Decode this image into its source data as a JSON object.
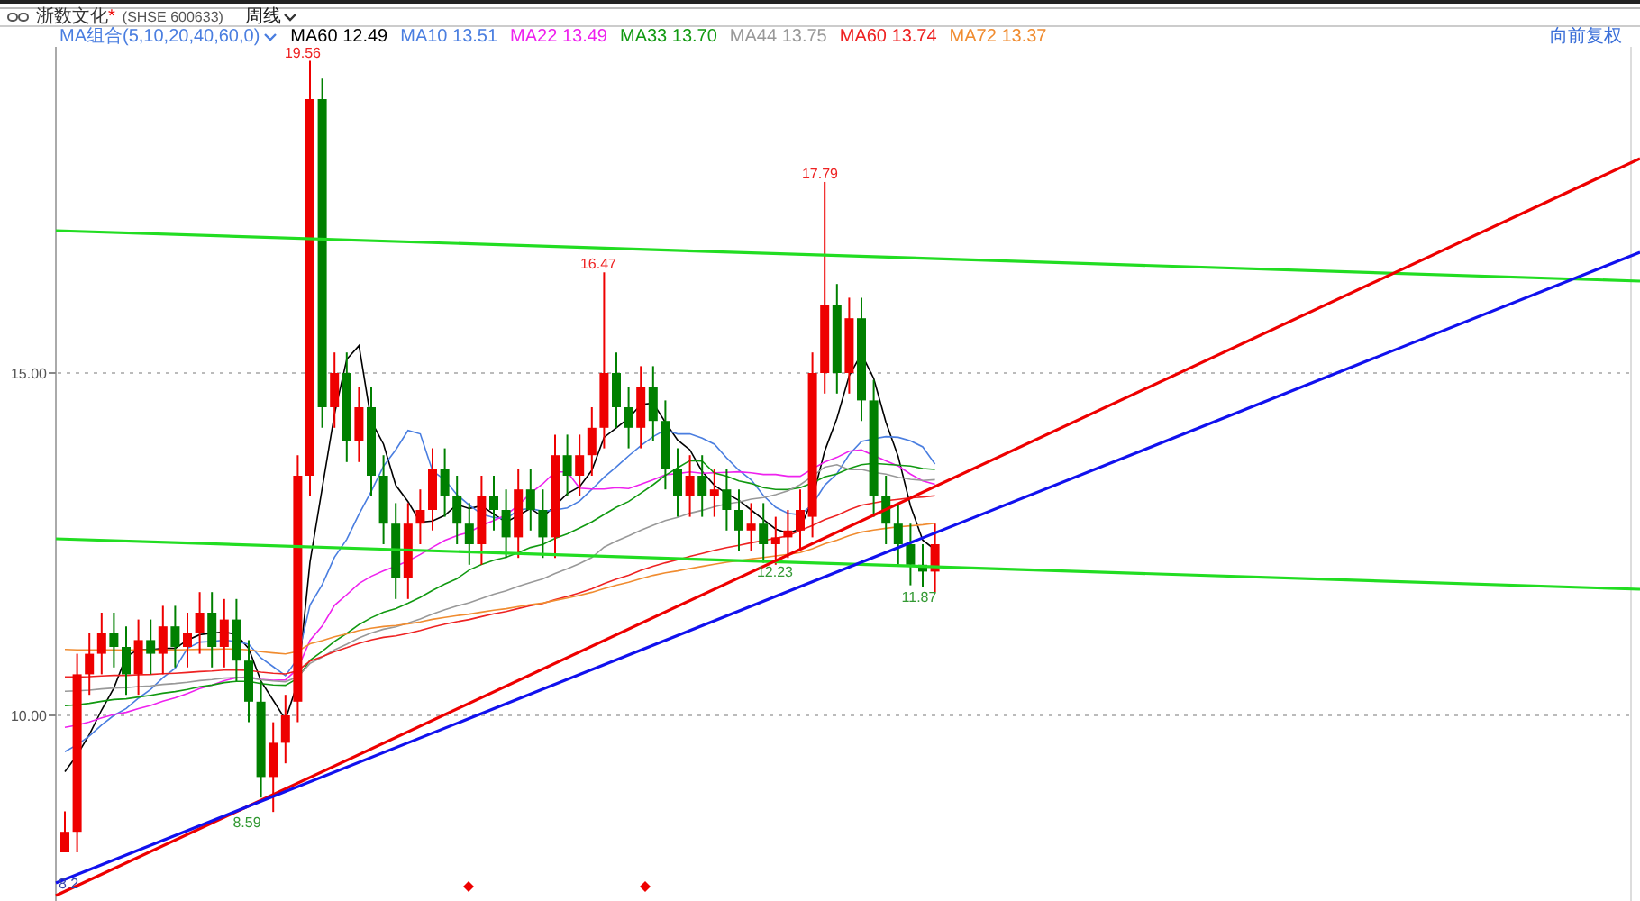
{
  "header": {
    "stock_name": "浙数文化",
    "name_mark": "*",
    "code": "(SHSE 600633)",
    "period": "周线"
  },
  "legend": {
    "group": "MA组合(5,10,20,40,60,0)",
    "items": [
      {
        "label": "MA60 12.49",
        "color": "#000000"
      },
      {
        "label": "MA10 13.51",
        "color": "#4a7ee0"
      },
      {
        "label": "MA22 13.49",
        "color": "#ee22ee"
      },
      {
        "label": "MA33 13.70",
        "color": "#119911"
      },
      {
        "label": "MA44 13.75",
        "color": "#999999"
      },
      {
        "label": "MA60 13.74",
        "color": "#ee2222"
      },
      {
        "label": "MA72 13.37",
        "color": "#f08c30"
      }
    ]
  },
  "adjust_label": "向前复权",
  "y_axis": [
    "15.00",
    "10.00"
  ],
  "price_labels": [
    {
      "text": "19.56",
      "kind": "high"
    },
    {
      "text": "16.47",
      "kind": "high"
    },
    {
      "text": "17.79",
      "kind": "high"
    },
    {
      "text": "12.23",
      "kind": "low"
    },
    {
      "text": "11.87",
      "kind": "low"
    },
    {
      "text": "8.59",
      "kind": "low"
    },
    {
      "text": "8.2",
      "kind": "low"
    }
  ]
}
